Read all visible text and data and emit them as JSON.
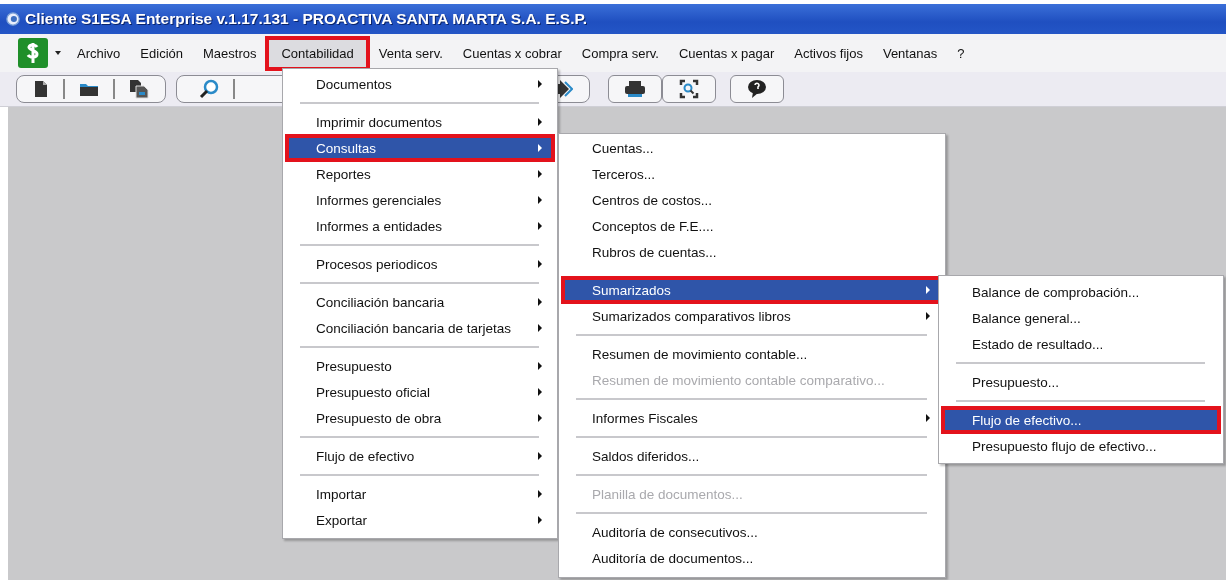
{
  "window": {
    "title": "Cliente S1ESA Enterprise v.1.17.131 - PROACTIVA SANTA MARTA S.A. E.S.P."
  },
  "menubar": {
    "items": [
      {
        "label": "Archivo",
        "selected": false,
        "outlined": false
      },
      {
        "label": "Edición",
        "selected": false,
        "outlined": false
      },
      {
        "label": "Maestros",
        "selected": false,
        "outlined": false
      },
      {
        "label": "Contabilidad",
        "selected": true,
        "outlined": true
      },
      {
        "label": "Venta serv.",
        "selected": false,
        "outlined": false
      },
      {
        "label": "Cuentas x cobrar",
        "selected": false,
        "outlined": false
      },
      {
        "label": "Compra serv.",
        "selected": false,
        "outlined": false
      },
      {
        "label": "Cuentas x pagar",
        "selected": false,
        "outlined": false
      },
      {
        "label": "Activos fijos",
        "selected": false,
        "outlined": false
      },
      {
        "label": "Ventanas",
        "selected": false,
        "outlined": false
      },
      {
        "label": "?",
        "selected": false,
        "outlined": false
      }
    ]
  },
  "menus": [
    {
      "items": [
        {
          "kind": "item",
          "label": "Documentos",
          "submenu": true,
          "selected": false,
          "outlined": false,
          "disabled": false
        },
        {
          "kind": "separator"
        },
        {
          "kind": "item",
          "label": "Imprimir documentos",
          "submenu": true,
          "selected": false,
          "outlined": false,
          "disabled": false
        },
        {
          "kind": "item",
          "label": "Consultas",
          "submenu": true,
          "selected": true,
          "outlined": true,
          "disabled": false
        },
        {
          "kind": "item",
          "label": "Reportes",
          "submenu": true,
          "selected": false,
          "outlined": false,
          "disabled": false
        },
        {
          "kind": "item",
          "label": "Informes gerenciales",
          "submenu": true,
          "selected": false,
          "outlined": false,
          "disabled": false
        },
        {
          "kind": "item",
          "label": "Informes a entidades",
          "submenu": true,
          "selected": false,
          "outlined": false,
          "disabled": false
        },
        {
          "kind": "separator"
        },
        {
          "kind": "item",
          "label": "Procesos periodicos",
          "submenu": true,
          "selected": false,
          "outlined": false,
          "disabled": false
        },
        {
          "kind": "separator"
        },
        {
          "kind": "item",
          "label": "Conciliación bancaria",
          "submenu": true,
          "selected": false,
          "outlined": false,
          "disabled": false
        },
        {
          "kind": "item",
          "label": "Conciliación bancaria de tarjetas",
          "submenu": true,
          "selected": false,
          "outlined": false,
          "disabled": false
        },
        {
          "kind": "separator"
        },
        {
          "kind": "item",
          "label": "Presupuesto",
          "submenu": true,
          "selected": false,
          "outlined": false,
          "disabled": false
        },
        {
          "kind": "item",
          "label": "Presupuesto oficial",
          "submenu": true,
          "selected": false,
          "outlined": false,
          "disabled": false
        },
        {
          "kind": "item",
          "label": "Presupuesto de obra",
          "submenu": true,
          "selected": false,
          "outlined": false,
          "disabled": false
        },
        {
          "kind": "separator"
        },
        {
          "kind": "item",
          "label": "Flujo de efectivo",
          "submenu": true,
          "selected": false,
          "outlined": false,
          "disabled": false
        },
        {
          "kind": "separator"
        },
        {
          "kind": "item",
          "label": "Importar",
          "submenu": true,
          "selected": false,
          "outlined": false,
          "disabled": false
        },
        {
          "kind": "item",
          "label": "Exportar",
          "submenu": true,
          "selected": false,
          "outlined": false,
          "disabled": false
        }
      ]
    },
    {
      "items": [
        {
          "kind": "item",
          "label": "Cuentas...",
          "submenu": false,
          "selected": false,
          "outlined": false,
          "disabled": false
        },
        {
          "kind": "item",
          "label": "Terceros...",
          "submenu": false,
          "selected": false,
          "outlined": false,
          "disabled": false
        },
        {
          "kind": "item",
          "label": "Centros de costos...",
          "submenu": false,
          "selected": false,
          "outlined": false,
          "disabled": false
        },
        {
          "kind": "item",
          "label": "Conceptos de F.E....",
          "submenu": false,
          "selected": false,
          "outlined": false,
          "disabled": false
        },
        {
          "kind": "item",
          "label": "Rubros de cuentas...",
          "submenu": false,
          "selected": false,
          "outlined": false,
          "disabled": false
        },
        {
          "kind": "gap"
        },
        {
          "kind": "item",
          "label": "Sumarizados",
          "submenu": true,
          "selected": true,
          "outlined": true,
          "disabled": false
        },
        {
          "kind": "item",
          "label": "Sumarizados comparativos libros",
          "submenu": true,
          "selected": false,
          "outlined": false,
          "disabled": false
        },
        {
          "kind": "separator"
        },
        {
          "kind": "item",
          "label": "Resumen de movimiento contable...",
          "submenu": false,
          "selected": false,
          "outlined": false,
          "disabled": false
        },
        {
          "kind": "item",
          "label": "Resumen de movimiento contable comparativo...",
          "submenu": false,
          "selected": false,
          "outlined": false,
          "disabled": true
        },
        {
          "kind": "separator"
        },
        {
          "kind": "item",
          "label": "Informes Fiscales",
          "submenu": true,
          "selected": false,
          "outlined": false,
          "disabled": false
        },
        {
          "kind": "separator"
        },
        {
          "kind": "item",
          "label": "Saldos diferidos...",
          "submenu": false,
          "selected": false,
          "outlined": false,
          "disabled": false
        },
        {
          "kind": "separator"
        },
        {
          "kind": "item",
          "label": "Planilla de documentos...",
          "submenu": false,
          "selected": false,
          "outlined": false,
          "disabled": true
        },
        {
          "kind": "separator"
        },
        {
          "kind": "item",
          "label": "Auditoría de consecutivos...",
          "submenu": false,
          "selected": false,
          "outlined": false,
          "disabled": false
        },
        {
          "kind": "item",
          "label": "Auditoría de documentos...",
          "submenu": false,
          "selected": false,
          "outlined": false,
          "disabled": false
        }
      ]
    },
    {
      "items": [
        {
          "kind": "item",
          "label": "Balance de comprobación...",
          "submenu": false,
          "selected": false,
          "outlined": false,
          "disabled": false
        },
        {
          "kind": "item",
          "label": "Balance general...",
          "submenu": false,
          "selected": false,
          "outlined": false,
          "disabled": false
        },
        {
          "kind": "item",
          "label": "Estado de resultado...",
          "submenu": false,
          "selected": false,
          "outlined": false,
          "disabled": false
        },
        {
          "kind": "separator"
        },
        {
          "kind": "item",
          "label": "Presupuesto...",
          "submenu": false,
          "selected": false,
          "outlined": false,
          "disabled": false
        },
        {
          "kind": "separator"
        },
        {
          "kind": "item",
          "label": "Flujo de efectivo...",
          "submenu": false,
          "selected": true,
          "outlined": true,
          "disabled": false
        },
        {
          "kind": "item",
          "label": "Presupuesto flujo de efectivo...",
          "submenu": false,
          "selected": false,
          "outlined": false,
          "disabled": false
        }
      ]
    }
  ]
}
